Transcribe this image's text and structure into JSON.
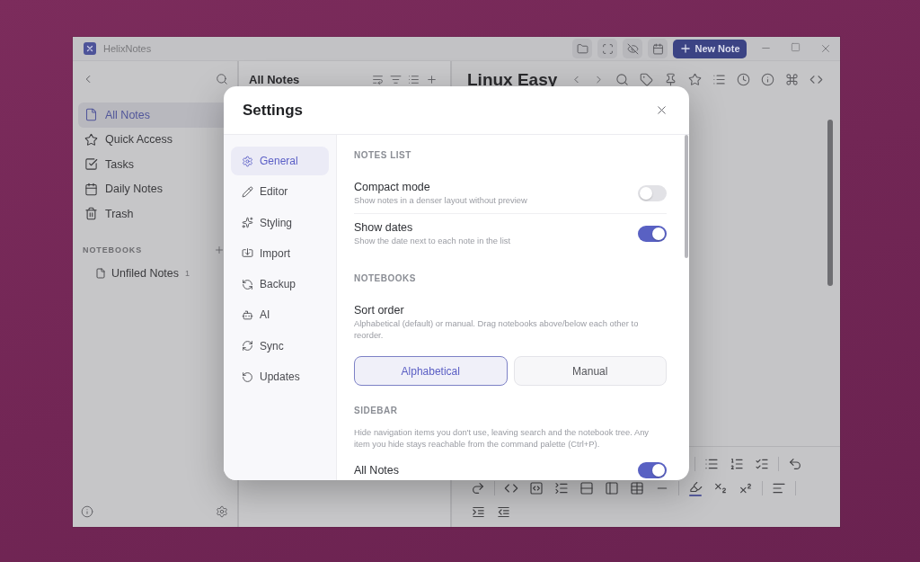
{
  "window": {
    "app_name": "HelixNotes",
    "new_note_label": "New Note"
  },
  "sidebar": {
    "items": [
      {
        "label": "All Notes",
        "selected": true
      },
      {
        "label": "Quick Access",
        "selected": false
      },
      {
        "label": "Tasks",
        "selected": false
      },
      {
        "label": "Daily Notes",
        "selected": false
      },
      {
        "label": "Trash",
        "selected": false
      }
    ],
    "notebooks_heading": "NOTEBOOKS",
    "notebooks": [
      {
        "label": "Unfiled Notes",
        "count": "1",
        "selected": false
      }
    ]
  },
  "notes_list": {
    "title": "All Notes"
  },
  "editor": {
    "title": "Linux Easy"
  },
  "settings": {
    "title": "Settings",
    "nav": [
      {
        "label": "General",
        "selected": true
      },
      {
        "label": "Editor",
        "selected": false
      },
      {
        "label": "Styling",
        "selected": false
      },
      {
        "label": "Import",
        "selected": false
      },
      {
        "label": "Backup",
        "selected": false
      },
      {
        "label": "AI",
        "selected": false
      },
      {
        "label": "Sync",
        "selected": false
      },
      {
        "label": "Updates",
        "selected": false
      }
    ],
    "sections": [
      {
        "heading": "NOTES LIST",
        "rows": [
          {
            "kind": "toggle",
            "label": "Compact mode",
            "description": "Show notes in a denser layout without preview",
            "on": false
          },
          {
            "kind": "toggle",
            "label": "Show dates",
            "description": "Show the date next to each note in the list",
            "on": true
          }
        ]
      },
      {
        "heading": "NOTEBOOKS",
        "rows": [
          {
            "kind": "choice",
            "label": "Sort order",
            "description": "Alphabetical (default) or manual. Drag notebooks above/below each other to reorder.",
            "options": [
              {
                "label": "Alphabetical",
                "selected": true
              },
              {
                "label": "Manual",
                "selected": false
              }
            ]
          }
        ]
      },
      {
        "heading": "SIDEBAR",
        "description": "Hide navigation items you don't use, leaving search and the notebook tree. Any item you hide stays reachable from the command palette (Ctrl+P).",
        "rows": [
          {
            "kind": "toggle",
            "label": "All Notes",
            "on": true
          }
        ]
      }
    ]
  }
}
